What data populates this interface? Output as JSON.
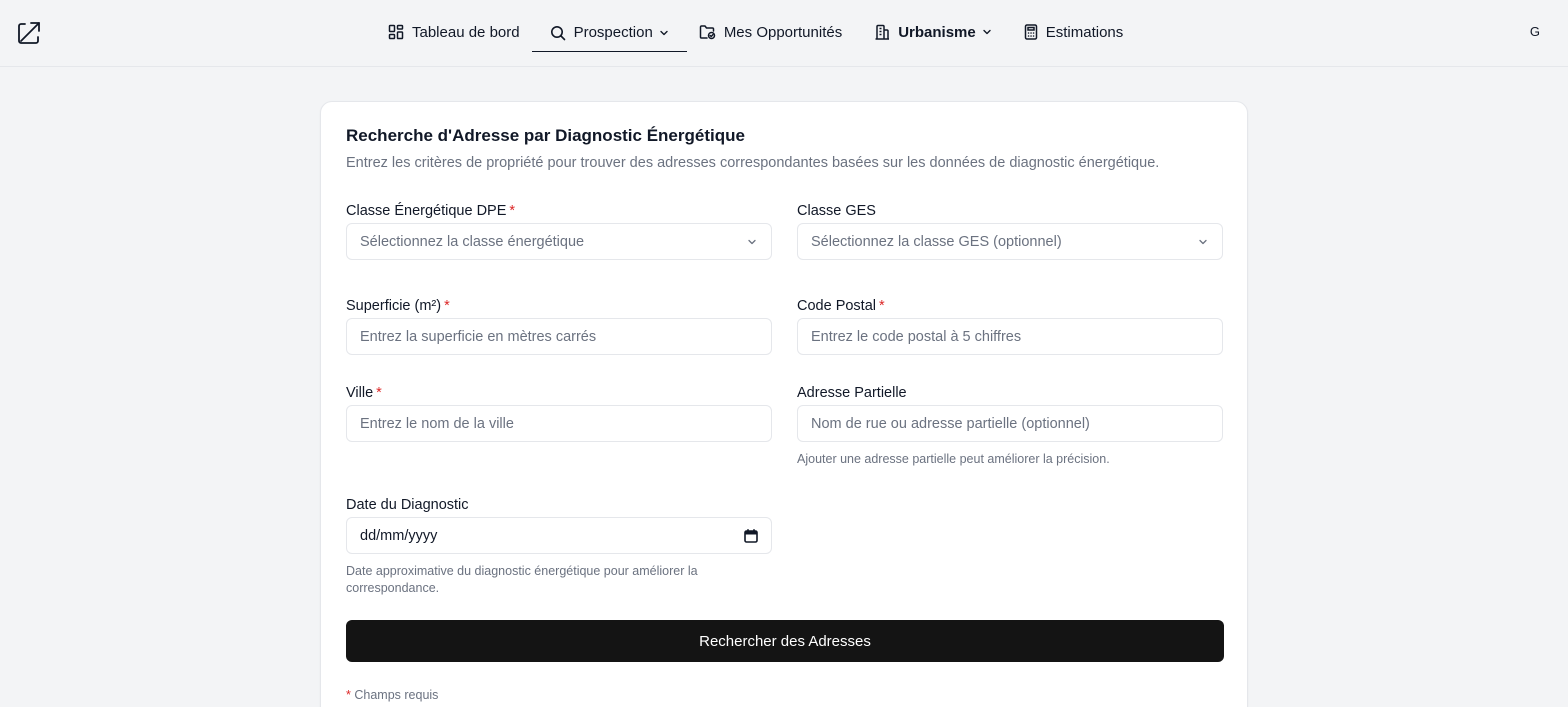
{
  "header": {
    "nav": [
      {
        "label": "Tableau de bord",
        "icon": "dashboard-icon"
      },
      {
        "label": "Prospection",
        "icon": "search-icon",
        "active": true,
        "dropdown": true
      },
      {
        "label": "Mes Opportunités",
        "icon": "folder-check-icon"
      },
      {
        "label": "Urbanisme",
        "icon": "building-icon",
        "dropdown": true
      },
      {
        "label": "Estimations",
        "icon": "calculator-icon"
      }
    ],
    "user_initial": "G"
  },
  "form": {
    "title": "Recherche d'Adresse par Diagnostic Énergétique",
    "description": "Entrez les critères de propriété pour trouver des adresses correspondantes basées sur les données de diagnostic énergétique.",
    "dpe": {
      "label": "Classe Énergétique DPE",
      "required_mark": "*",
      "placeholder": "Sélectionnez la classe énergétique"
    },
    "ges": {
      "label": "Classe GES",
      "placeholder": "Sélectionnez la classe GES (optionnel)"
    },
    "surface": {
      "label": "Superficie (m²)",
      "required_mark": "*",
      "placeholder": "Entrez la superficie en mètres carrés"
    },
    "postal": {
      "label": "Code Postal",
      "required_mark": "*",
      "placeholder": "Entrez le code postal à 5 chiffres"
    },
    "city": {
      "label": "Ville",
      "required_mark": "*",
      "placeholder": "Entrez le nom de la ville"
    },
    "address": {
      "label": "Adresse Partielle",
      "placeholder": "Nom de rue ou adresse partielle (optionnel)",
      "help": "Ajouter une adresse partielle peut améliorer la précision."
    },
    "date": {
      "label": "Date du Diagnostic",
      "value": "dd/mm/yyyy",
      "help": "Date approximative du diagnostic énergétique pour améliorer la correspondance."
    },
    "submit_label": "Rechercher des Adresses",
    "required_note_mark": "*",
    "required_note": "Champs requis"
  },
  "colors": {
    "accent": "#141414",
    "required": "#dc2626",
    "muted": "#6b7280"
  }
}
